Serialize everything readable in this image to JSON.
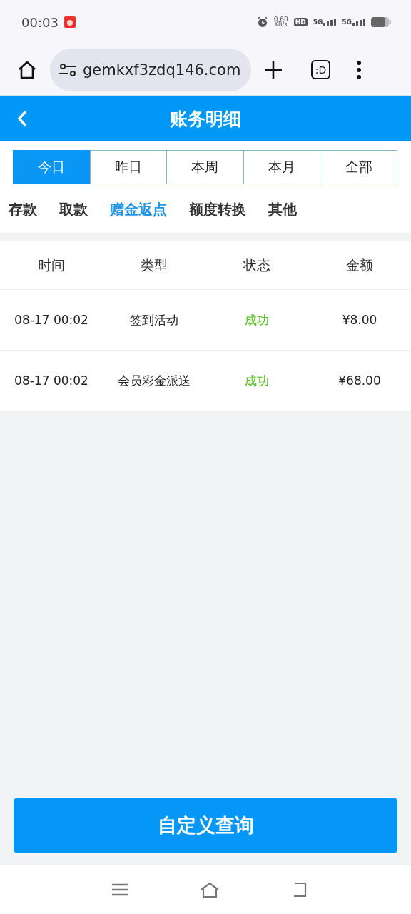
{
  "status_bar": {
    "time": "00:03",
    "speed_value": "0.60",
    "speed_unit": "KB/s",
    "hd_label": "HD",
    "sim_labels": [
      "5G",
      "5G"
    ]
  },
  "browser": {
    "url": "gemkxf3zdq146.com",
    "tab_label": ":D"
  },
  "header": {
    "title": "账务明细"
  },
  "periods": [
    {
      "label": "今日",
      "selected": true
    },
    {
      "label": "昨日",
      "selected": false
    },
    {
      "label": "本周",
      "selected": false
    },
    {
      "label": "本月",
      "selected": false
    },
    {
      "label": "全部",
      "selected": false
    }
  ],
  "categories": [
    {
      "label": "存款",
      "selected": false
    },
    {
      "label": "取款",
      "selected": false
    },
    {
      "label": "赠金返点",
      "selected": true
    },
    {
      "label": "额度转换",
      "selected": false
    },
    {
      "label": "其他",
      "selected": false
    }
  ],
  "table": {
    "columns": [
      "时间",
      "类型",
      "状态",
      "金额"
    ],
    "rows": [
      {
        "time": "08-17 00:02",
        "type": "签到活动",
        "status": "成功",
        "color": "#52c41a",
        "amount": "¥8.00"
      },
      {
        "time": "08-17 00:02",
        "type": "会员彩金派送",
        "status": "成功",
        "color": "#52c41a",
        "amount": "¥68.00"
      }
    ]
  },
  "query_button": "自定义查询"
}
